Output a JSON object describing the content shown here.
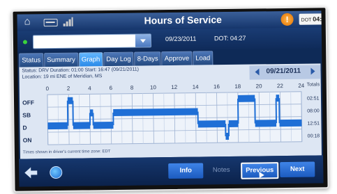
{
  "header": {
    "title": "Hours of Service",
    "alert_glyph": "!",
    "dot_chip_label": "DOT",
    "dot_chip_value": "04:"
  },
  "driver_row": {
    "selected_driver": "",
    "date": "09/23/2011",
    "dot_time": "DOT: 04:27"
  },
  "tabs": [
    {
      "label": "Status",
      "active": false
    },
    {
      "label": "Summary",
      "active": false
    },
    {
      "label": "Graph",
      "active": true
    },
    {
      "label": "Day Log",
      "active": false
    },
    {
      "label": "8-Days",
      "active": false
    },
    {
      "label": "Approve",
      "active": false
    },
    {
      "label": "Load",
      "active": false
    }
  ],
  "graph": {
    "status_line": "Status: DRV   Duration: 01:00   Start: 16:47 (09/21/2011)",
    "location_line": "Location: 19 mi ENE of Meridian, MS",
    "date": "09/21/2011",
    "hour_labels": [
      "0",
      "2",
      "4",
      "6",
      "8",
      "10",
      "12",
      "14",
      "16",
      "18",
      "20",
      "22",
      "24"
    ],
    "totals_header": "Totals",
    "rows": [
      {
        "label": "OFF",
        "total": "02:51"
      },
      {
        "label": "SB",
        "total": "08:00"
      },
      {
        "label": "D",
        "total": "12:51"
      },
      {
        "label": "ON",
        "total": "00:18"
      }
    ],
    "timeline": [
      {
        "status": "D",
        "start": 0.0,
        "end": 1.9
      },
      {
        "status": "OFF",
        "start": 1.9,
        "end": 2.4
      },
      {
        "status": "D",
        "start": 2.4,
        "end": 4.0
      },
      {
        "status": "SB",
        "start": 4.0,
        "end": 4.3
      },
      {
        "status": "D",
        "start": 4.3,
        "end": 6.2
      },
      {
        "status": "SB",
        "start": 6.2,
        "end": 14.2
      },
      {
        "status": "D",
        "start": 14.2,
        "end": 16.8
      },
      {
        "status": "ON",
        "start": 16.8,
        "end": 17.1
      },
      {
        "status": "D",
        "start": 17.1,
        "end": 18.0
      },
      {
        "status": "OFF",
        "start": 18.0,
        "end": 19.6
      },
      {
        "status": "D",
        "start": 19.6,
        "end": 21.6
      },
      {
        "status": "OFF",
        "start": 21.6,
        "end": 21.9
      },
      {
        "status": "D",
        "start": 21.9,
        "end": 24.0
      }
    ],
    "timezone_note": "Times shown in driver's current time zone: EDT",
    "bar_color": "#1f6fd6"
  },
  "footer": {
    "info_label": "Info",
    "notes_label": "Notes",
    "previous_label": "Previous",
    "next_label": "Next"
  }
}
